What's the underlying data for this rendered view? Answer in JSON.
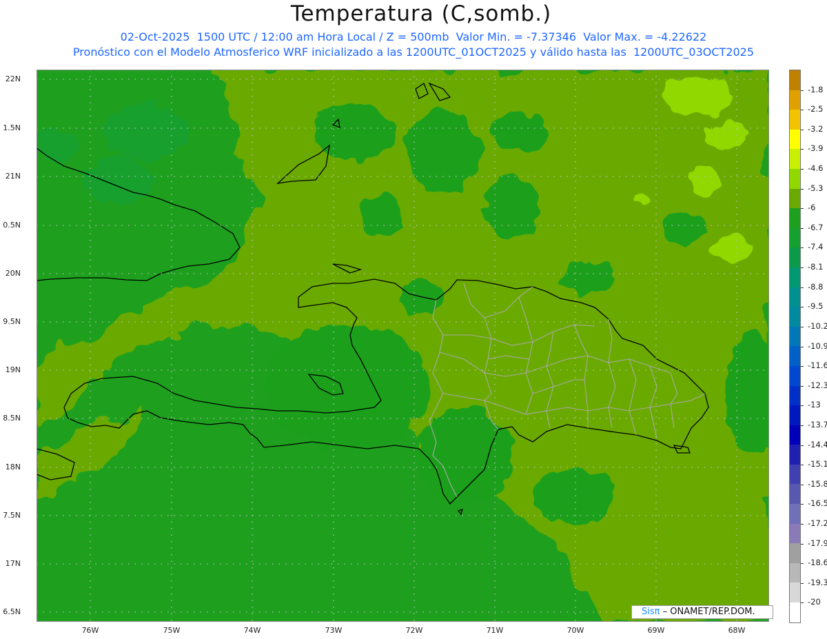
{
  "header": {
    "title": "Temperatura (C,somb.)",
    "line1": "02-Oct-2025  1500 UTC / 12:00 am Hora Local / Z = 500mb  Valor Min. = -7.37346  Valor Max. = -4.22622",
    "line2": "Pronóstico con el Modelo Atmosferico WRF inicializado a las 1200UTC_01OCT2025 y válido hasta las  1200UTC_03OCT2025"
  },
  "axes": {
    "lat_labels": [
      "22N",
      "1.5N",
      "21N",
      "0.5N",
      "20N",
      "9.5N",
      "19N",
      "8.5N",
      "18N",
      "7.5N",
      "17N",
      "6.5N"
    ],
    "lon_labels": [
      "76W",
      "75W",
      "74W",
      "73W",
      "72W",
      "71W",
      "70W",
      "69W",
      "68W"
    ]
  },
  "colorbar": {
    "labels": [
      "-1.8",
      "-2.5",
      "-3.2",
      "-3.9",
      "-4.6",
      "-5.3",
      "-6",
      "-6.7",
      "-7.4",
      "-8.1",
      "-8.8",
      "-9.5",
      "-10.2",
      "-10.9",
      "-11.6",
      "-12.3",
      "-13",
      "-13.7",
      "-14.4",
      "-15.1",
      "-15.8",
      "-16.5",
      "-17.2",
      "-17.9",
      "-18.6",
      "-19.3",
      "-20"
    ],
    "colors": [
      "#c08000",
      "#e0a000",
      "#f2c400",
      "#ffff00",
      "#c8f000",
      "#90d800",
      "#6aaa00",
      "#1ea01e",
      "#16a030",
      "#0a9a4a",
      "#009870",
      "#009090",
      "#008aa0",
      "#0078b8",
      "#0060c8",
      "#0048d0",
      "#0030c8",
      "#0018c0",
      "#0000b8",
      "#2020b0",
      "#4040b0",
      "#5858b0",
      "#7070b8",
      "#8a7ab8",
      "#a0a0a0",
      "#b8b8b8",
      "#d8d8d8",
      "#ffffff"
    ]
  },
  "field": {
    "colors": {
      "dark": "#1ea01e",
      "mid": "#40a818",
      "light": "#6aaa00",
      "lightest": "#90d800"
    }
  },
  "credit": {
    "brand": "Sisπ",
    "org": "– ONAMET/REP.DOM."
  }
}
